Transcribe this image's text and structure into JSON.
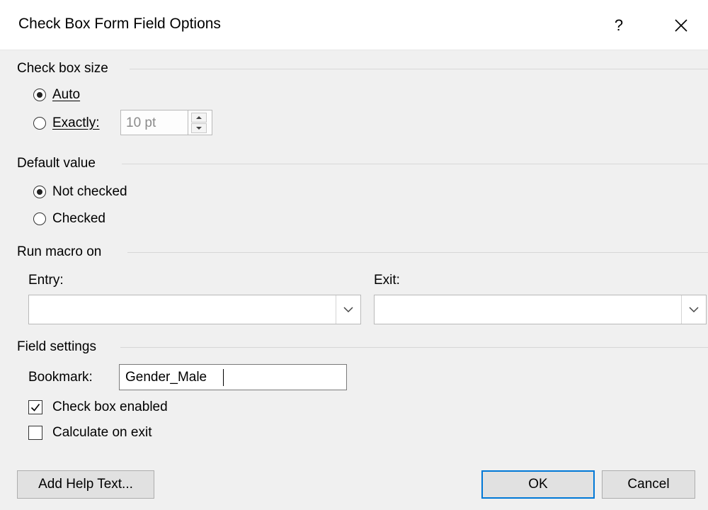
{
  "window": {
    "title": "Check Box Form Field Options",
    "help_glyph": "?",
    "close_glyph": "✕"
  },
  "size_group": {
    "label": "Check box size",
    "options": [
      {
        "label": "Auto",
        "selected": true
      },
      {
        "label": "Exactly:",
        "selected": false
      }
    ],
    "exact_value": "10 pt"
  },
  "default_group": {
    "label": "Default value",
    "options": [
      {
        "label": "Not checked",
        "selected": true
      },
      {
        "label": "Checked",
        "selected": false
      }
    ]
  },
  "macro_group": {
    "label": "Run macro on",
    "entry_label": "Entry:",
    "entry_value": "",
    "exit_label": "Exit:",
    "exit_value": ""
  },
  "field_settings": {
    "label": "Field settings",
    "bookmark_label": "Bookmark:",
    "bookmark_value": "Gender_Male",
    "checkboxes": [
      {
        "label": "Check box enabled",
        "checked": true
      },
      {
        "label": "Calculate on exit",
        "checked": false
      }
    ]
  },
  "buttons": {
    "help_text": "Add Help Text...",
    "ok": "OK",
    "cancel": "Cancel"
  }
}
